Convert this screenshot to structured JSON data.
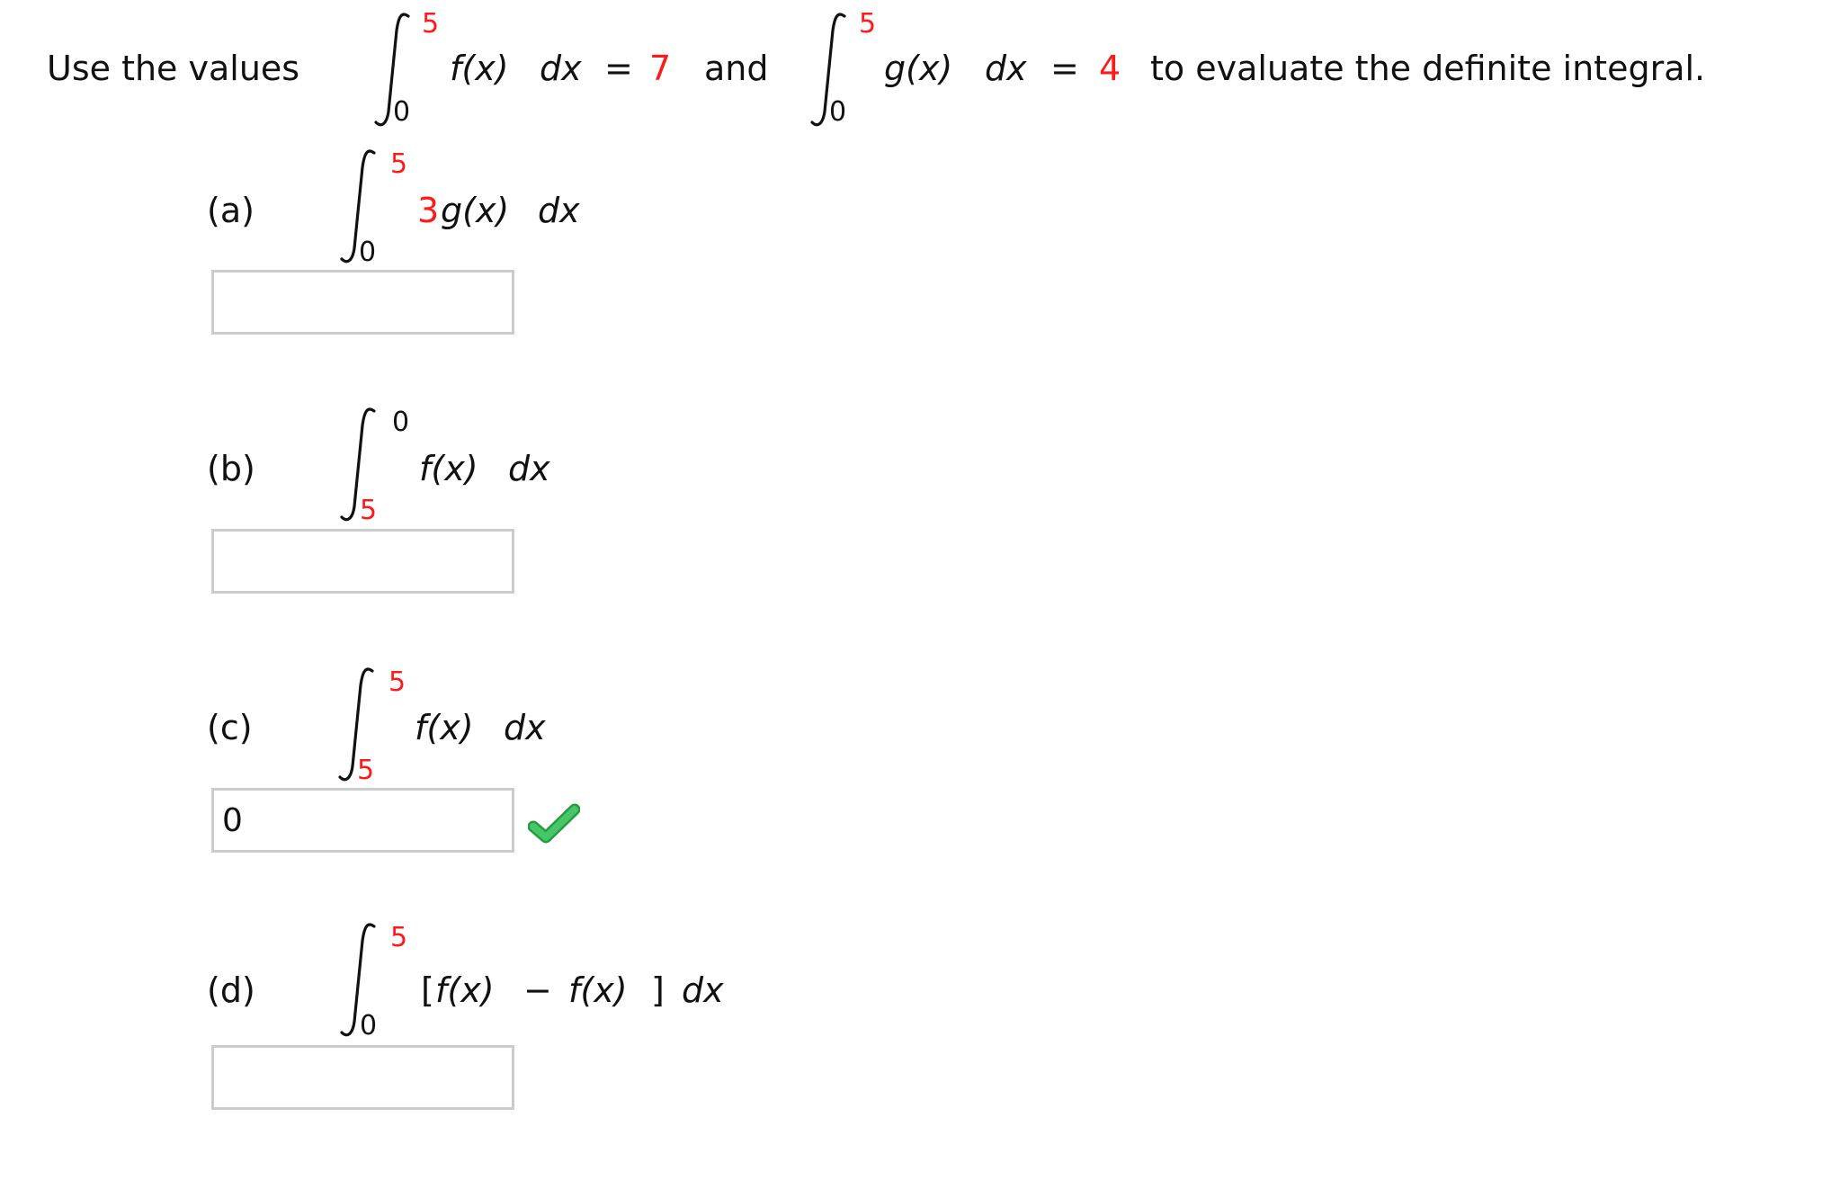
{
  "prompt": {
    "intro": "Use the values",
    "given1": {
      "upper": "5",
      "lower": "0",
      "integrand": "f(x)",
      "dx": "dx",
      "equals": "=",
      "value": "7"
    },
    "connector": "and",
    "given2": {
      "upper": "5",
      "lower": "0",
      "integrand": "g(x)",
      "dx": "dx",
      "equals": "=",
      "value": "4"
    },
    "tail": "to evaluate the definite integral."
  },
  "parts": [
    {
      "label": "(a)",
      "upper": "5",
      "lower": "0",
      "coef": "3",
      "integrand": "g(x)",
      "dx": "dx",
      "answer": "",
      "status": ""
    },
    {
      "label": "(b)",
      "upper": "0",
      "lower": "5",
      "integrand": "f(x)",
      "dx": "dx",
      "answer": "",
      "status": ""
    },
    {
      "label": "(c)",
      "upper": "5",
      "lower": "5",
      "integrand": "f(x)",
      "dx": "dx",
      "answer": "0",
      "status": "correct"
    },
    {
      "label": "(d)",
      "upper": "5",
      "lower": "0",
      "integrand_open": "[",
      "integrand_a": "f(x)",
      "minus": "−",
      "integrand_b": "f(x)",
      "integrand_close": "]",
      "dx": "dx",
      "answer": "",
      "status": ""
    }
  ],
  "colors": {
    "highlight": "#ff1a1a",
    "correct": "#3cb95a",
    "input_border": "#cccccc"
  }
}
